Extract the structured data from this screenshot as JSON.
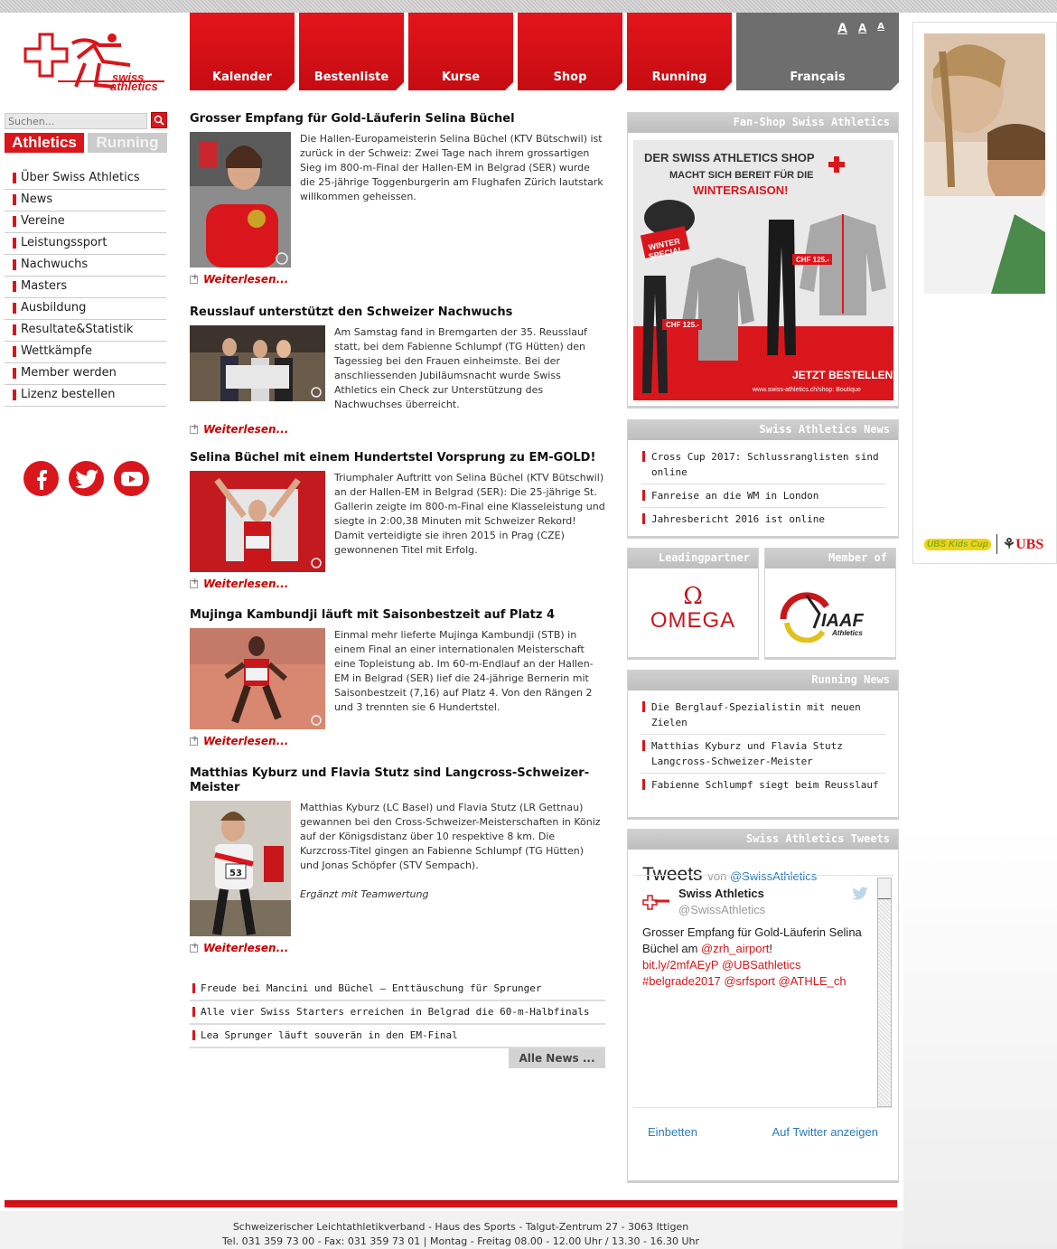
{
  "colors": {
    "brand_red": "#d9161c",
    "nav_grey": "#6e6e6e",
    "panel_head": "#c8c8c8"
  },
  "logo": {
    "text_line1": "swiss",
    "text_line2": "athletics"
  },
  "top_nav": {
    "items": [
      "Kalender",
      "Bestenliste",
      "Kurse",
      "Shop",
      "Running"
    ],
    "language": "Français",
    "font_sizes": [
      "A",
      "A",
      "A"
    ]
  },
  "search": {
    "placeholder": "Suchen..."
  },
  "site_tabs": {
    "athletics": "Athletics",
    "running": "Running"
  },
  "left_nav": [
    "Über Swiss Athletics",
    "News",
    "Vereine",
    "Leistungssport",
    "Nachwuchs",
    "Masters",
    "Ausbildung",
    "Resultate&Statistik",
    "Wettkämpfe",
    "Member werden",
    "Lizenz bestellen"
  ],
  "social": [
    "facebook-icon",
    "twitter-icon",
    "youtube-icon"
  ],
  "articles": [
    {
      "title": "Grosser Empfang für Gold-Läuferin Selina Büchel",
      "text": "Die Hallen-Europameisterin Selina Büchel (KTV Bütschwil) ist zurück in der Schweiz: Zwei Tage nach ihrem grossartigen Sieg im 800-m-Final der Hallen-EM in Belgrad (SER) wurde die 25-jährige Toggenburgerin am Flughafen Zürich lautstark willkommen geheissen.",
      "extra": "",
      "more": "Weiterlesen..."
    },
    {
      "title": "Reusslauf unterstützt den Schweizer Nachwuchs",
      "text": "Am Samstag fand in Bremgarten der 35. Reusslauf statt, bei dem Fabienne Schlumpf (TG Hütten) den Tagessieg bei den Frauen einheimste. Bei der anschliessenden Jubiläumsnacht wurde Swiss Athletics ein Check zur Unterstützung des Nachwuchses überreicht.",
      "extra": "",
      "more": "Weiterlesen..."
    },
    {
      "title": "Selina Büchel mit einem Hundertstel Vorsprung zu EM-GOLD!",
      "text": "Triumphaler Auftritt von Selina Büchel (KTV Bütschwil) an der Hallen-EM in Belgrad (SER): Die 25-jährige St. Gallerin zeigte im 800-m-Final eine Klasseleistung und siegte in 2:00,38 Minuten mit Schweizer Rekord! Damit verteidigte sie ihren 2015 in Prag (CZE) gewonnenen Titel mit Erfolg.",
      "extra": "",
      "more": "Weiterlesen..."
    },
    {
      "title": "Mujinga Kambundji läuft mit Saisonbestzeit auf Platz 4",
      "text": "Einmal mehr lieferte Mujinga Kambundji (STB) in einem Final an einer internationalen Meisterschaft eine Topleistung ab. Im 60-m-Endlauf an der Hallen-EM in Belgrad (SER) lief die 24-jährige Bernerin mit Saisonbestzeit (7,16) auf Platz 4. Von den Rängen 2 und 3 trennten sie 6 Hundertstel.",
      "extra": "",
      "more": "Weiterlesen..."
    },
    {
      "title": "Matthias Kyburz und Flavia Stutz sind Langcross-Schweizer-Meister",
      "text": "Matthias Kyburz (LC Basel) und Flavia Stutz (LR Gettnau) gewannen bei den Cross-Schweizer-Meisterschaften in Köniz auf der Königsdistanz über 10 respektive 8 km. Die Kurzcross-Titel gingen an Fabienne Schlumpf (TG Hütten) und Jonas Schöpfer (STV Sempach).",
      "extra": "Ergänzt mit Teamwertung",
      "more": "Weiterlesen..."
    }
  ],
  "news_list": [
    "Freude bei Mancini und Büchel – Enttäuschung für Sprunger",
    "Alle vier Swiss Starters erreichen in Belgrad die 60-m-Halbfinals",
    "Lea Sprunger läuft souverän in den EM-Final"
  ],
  "all_news": "Alle News ...",
  "fanshop": {
    "title": "Fan-Shop Swiss Athletics",
    "ad_line1": "DER SWISS ATHLETICS SHOP",
    "ad_line2": "MACHT SICH BEREIT FÜR DIE",
    "ad_line3": "WINTERSAISON!",
    "badge1": "WINTER",
    "badge2": "SPECIAL",
    "price": "CHF 125.-",
    "cta": "JETZT BESTELLEN!",
    "url": "www.swiss-athletics.ch/shop: Boutique"
  },
  "sa_news": {
    "title": "Swiss Athletics News",
    "items": [
      "Cross Cup 2017: Schlussranglisten sind online",
      "Fanreise an die WM in London",
      "Jahresbericht 2016 ist online"
    ]
  },
  "partners": {
    "leading_title": "Leadingpartner",
    "leading_logo": "OMEGA",
    "member_title": "Member of",
    "member_logo": "IAAF",
    "member_sub": "Athletics"
  },
  "running_news": {
    "title": "Running News",
    "items": [
      "Die Berglauf-Spezialistin mit neuen Zielen",
      "Matthias Kyburz und Flavia Stutz Langcross-Schweizer-Meister",
      "Fabienne Schlumpf siegt beim Reusslauf"
    ]
  },
  "tweets": {
    "title": "Swiss Athletics Tweets",
    "heading": "Tweets",
    "von": "von",
    "handle": "@SwissAthletics",
    "author": "Swiss Athletics",
    "author_handle": "@SwissAthletics",
    "tweet_text": "Grosser Empfang für Gold-Läuferin Selina Büchel am",
    "mention1": "@zrh_airport",
    "link": "bit.ly/2mfAEyP",
    "mention2": "@UBSathletics",
    "tags": "#belgrade2017 @srfsport @ATHLE_ch",
    "embed": "Einbetten",
    "view": "Auf Twitter anzeigen"
  },
  "sponsor": {
    "kids": "UBS Kids Cup",
    "ubs": "UBS"
  },
  "footer": {
    "line1": "Schweizerischer Leichtathletikverband - Haus des Sports - Talgut-Zentrum 27 - 3063 Ittigen",
    "line2": "Tel. 031 359 73 00 - Fax: 031 359 73 01 | Montag - Freitag 08.00 - 12.00 Uhr / 13.30 - 16.30 Uhr"
  }
}
